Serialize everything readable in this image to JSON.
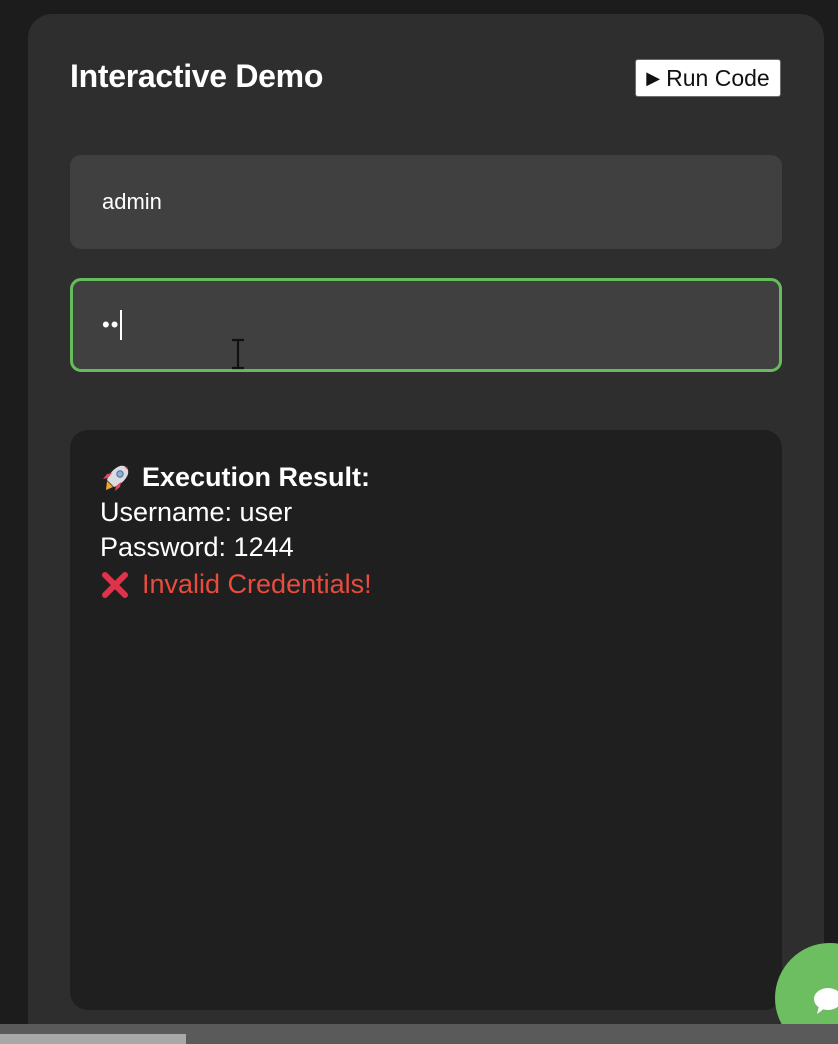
{
  "demo": {
    "title": "Interactive Demo",
    "run_button": {
      "icon": "play-icon",
      "label": "Run Code"
    }
  },
  "form": {
    "username_value": "admin",
    "password_masked": "••",
    "password_focus_color": "#66bb5a"
  },
  "result": {
    "heading_icon": "rocket-icon",
    "heading": "Execution Result:",
    "username_line": "Username: user",
    "password_line": "Password: 1244",
    "error_icon": "cross-mark-icon",
    "error": "Invalid Credentials!",
    "error_color": "#e94b3c"
  },
  "chat": {
    "icon": "chat-icon",
    "color": "#6dbe60"
  }
}
